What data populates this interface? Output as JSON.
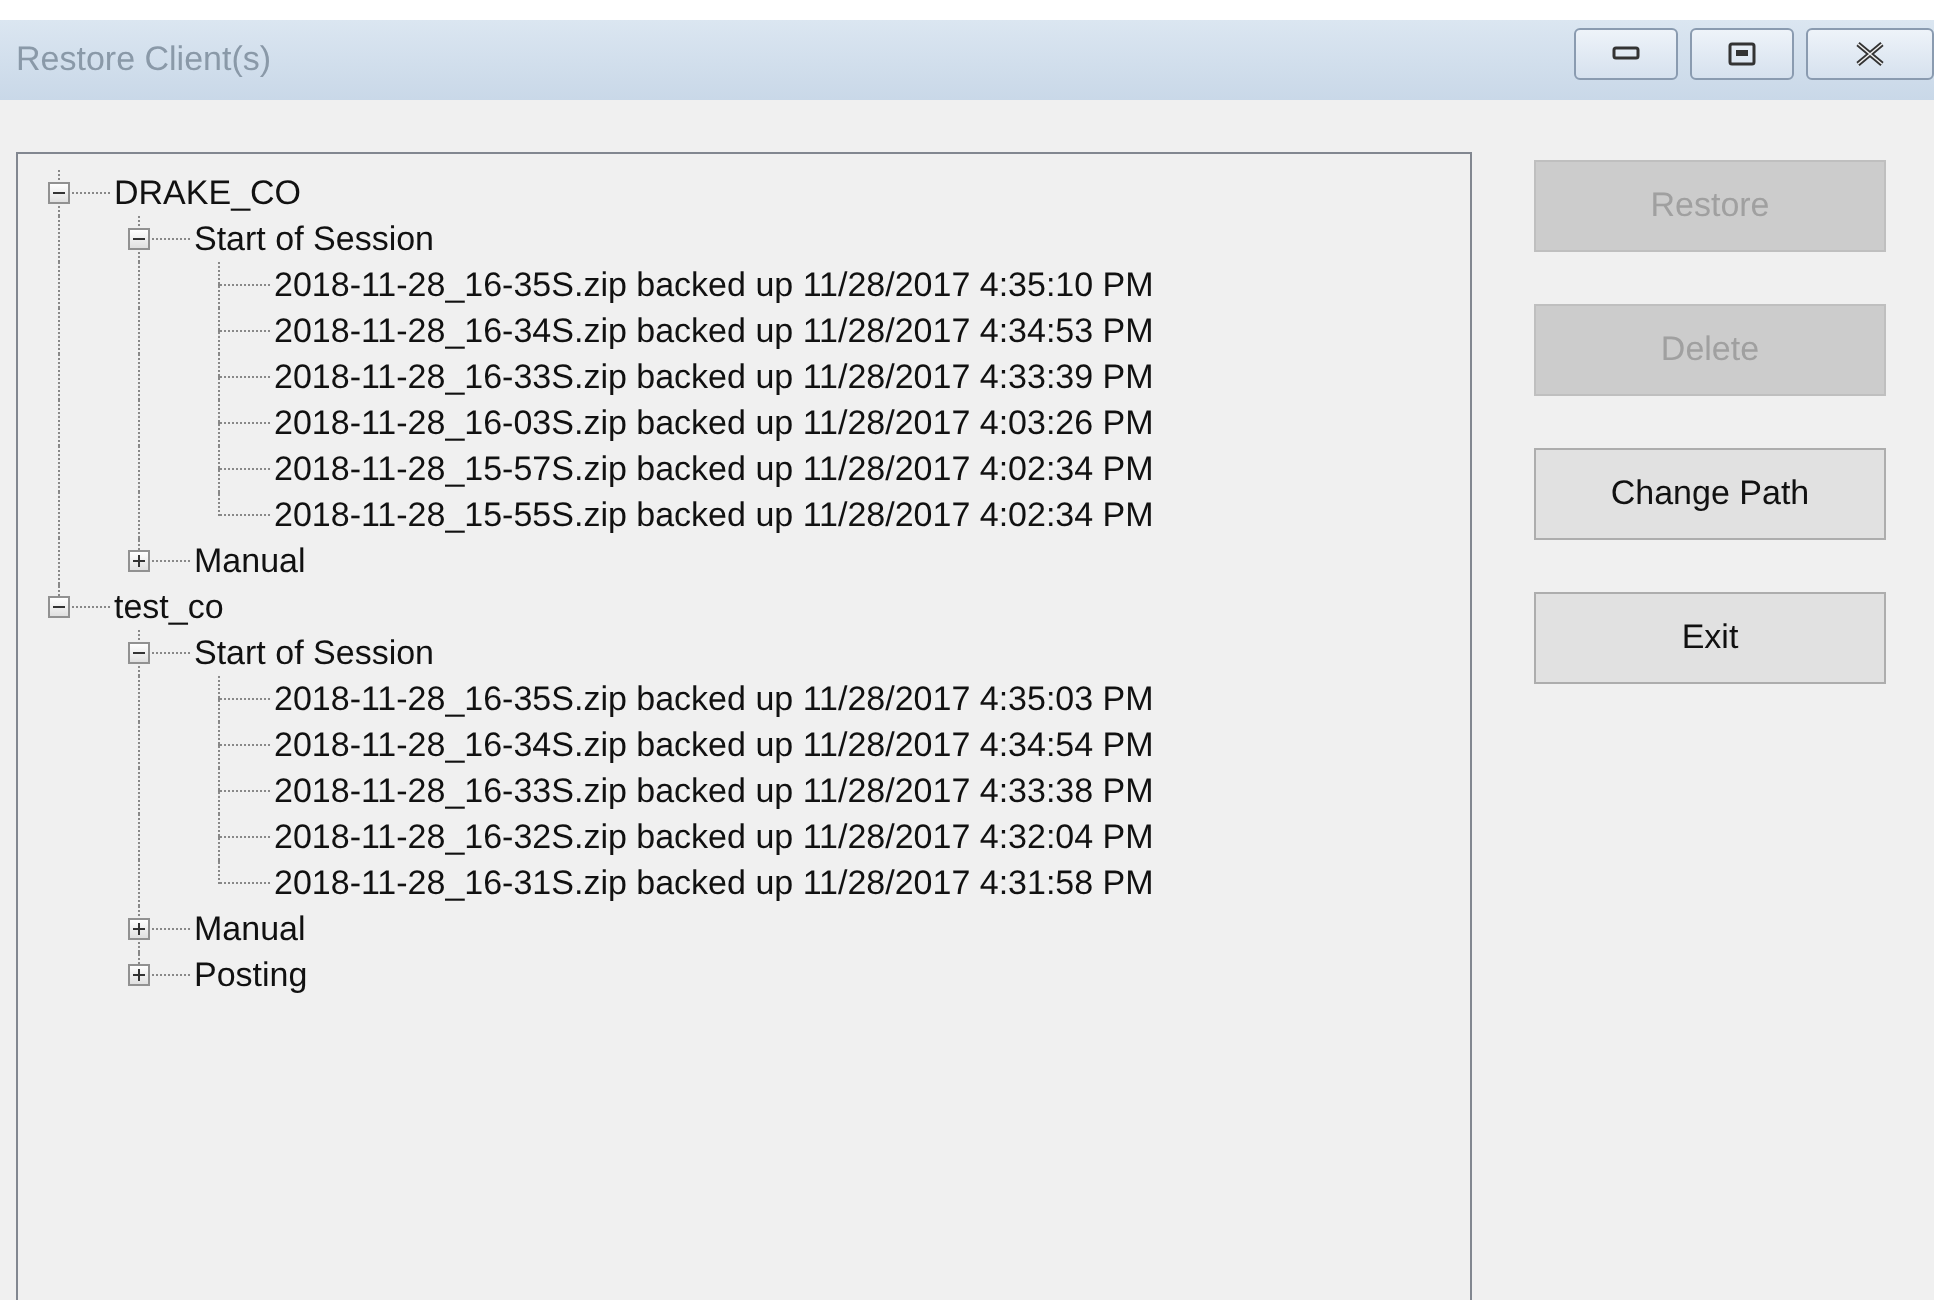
{
  "window": {
    "title": "Restore Client(s)"
  },
  "tree": [
    {
      "label": "DRAKE_CO",
      "expanded": true,
      "children": [
        {
          "label": "Start of Session",
          "expanded": true,
          "children": [
            {
              "label": "2018-11-28_16-35S.zip backed up 11/28/2017 4:35:10 PM"
            },
            {
              "label": "2018-11-28_16-34S.zip backed up 11/28/2017 4:34:53 PM"
            },
            {
              "label": "2018-11-28_16-33S.zip backed up 11/28/2017 4:33:39 PM"
            },
            {
              "label": "2018-11-28_16-03S.zip backed up 11/28/2017 4:03:26 PM"
            },
            {
              "label": "2018-11-28_15-57S.zip backed up 11/28/2017 4:02:34 PM"
            },
            {
              "label": "2018-11-28_15-55S.zip backed up 11/28/2017 4:02:34 PM"
            }
          ]
        },
        {
          "label": "Manual",
          "expanded": false
        }
      ]
    },
    {
      "label": "test_co",
      "expanded": true,
      "children": [
        {
          "label": "Start of Session",
          "expanded": true,
          "children": [
            {
              "label": "2018-11-28_16-35S.zip backed up 11/28/2017 4:35:03 PM"
            },
            {
              "label": "2018-11-28_16-34S.zip backed up 11/28/2017 4:34:54 PM"
            },
            {
              "label": "2018-11-28_16-33S.zip backed up 11/28/2017 4:33:38 PM"
            },
            {
              "label": "2018-11-28_16-32S.zip backed up 11/28/2017 4:32:04 PM"
            },
            {
              "label": "2018-11-28_16-31S.zip backed up 11/28/2017 4:31:58 PM"
            }
          ]
        },
        {
          "label": "Manual",
          "expanded": false
        },
        {
          "label": "Posting",
          "expanded": false
        }
      ]
    }
  ],
  "buttons": [
    {
      "label": "Restore",
      "disabled": true
    },
    {
      "label": "Delete",
      "disabled": true
    },
    {
      "label": "Change Path",
      "disabled": false
    },
    {
      "label": "Exit",
      "disabled": false
    }
  ]
}
